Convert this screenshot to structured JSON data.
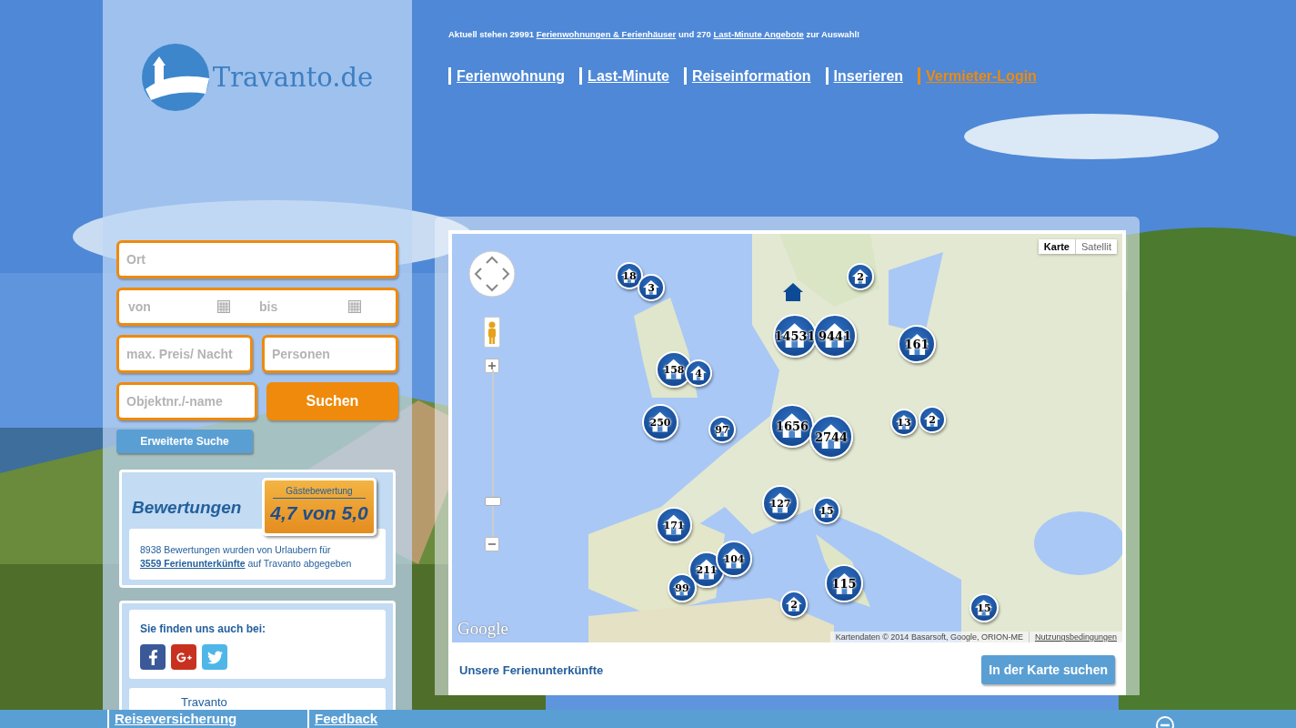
{
  "logo": {
    "text": "Travanto.de"
  },
  "notice": [
    {
      "text": "Aktuell stehen 29991 ",
      "link": false
    },
    {
      "text": "Ferienwohnungen & Ferienhäuser",
      "link": true
    },
    {
      "text": " und 270 ",
      "link": false
    },
    {
      "text": "Last-Minute Angebote",
      "link": true
    },
    {
      "text": " zur Auswahl!",
      "link": false
    }
  ],
  "nav": [
    {
      "label": "Ferienwohnung",
      "accent": false
    },
    {
      "label": "Last-Minute",
      "accent": false
    },
    {
      "label": "Reiseinformation",
      "accent": false
    },
    {
      "label": "Inserieren",
      "accent": false
    },
    {
      "label": "Vermieter-Login",
      "accent": true
    }
  ],
  "search": {
    "place": {
      "placeholder": "Ort"
    },
    "from": {
      "placeholder": "von"
    },
    "to": {
      "placeholder": "bis"
    },
    "price": {
      "placeholder": "max. Preis/ Nacht"
    },
    "persons": {
      "placeholder": "Personen"
    },
    "object": {
      "placeholder": "Objektnr./-name"
    },
    "submit": "Suchen",
    "advanced": "Erweiterte Suche"
  },
  "reviews": {
    "title": "Bewertungen",
    "badge_label": "Gästebewertung",
    "badge_score": "4,7 von 5,0",
    "text": [
      {
        "text": "8938 Bewertungen wurden von Urlaubern für ",
        "link": false
      },
      {
        "text": "3559 Ferienunterkünfte",
        "link": true
      },
      {
        "text": " auf Travanto abgegeben",
        "link": false
      }
    ]
  },
  "social": {
    "title": "Sie finden uns auch bei:",
    "networks": [
      {
        "kind": "facebook"
      },
      {
        "kind": "googleplus"
      },
      {
        "kind": "twitter"
      }
    ]
  },
  "more_box": {
    "title": "Travanto"
  },
  "map": {
    "types": [
      {
        "label": "Karte",
        "selected": true
      },
      {
        "label": "Satellit",
        "selected": false
      }
    ],
    "zoom": {
      "level": 0.21
    },
    "markers": [
      {
        "count": "18"
      },
      {
        "count": "3"
      },
      {
        "count": "2"
      },
      {
        "count": "14531"
      },
      {
        "count": "9441"
      },
      {
        "count": "161"
      },
      {
        "count": "158"
      },
      {
        "count": "4"
      },
      {
        "count": "250"
      },
      {
        "count": "97"
      },
      {
        "count": "1656"
      },
      {
        "count": "2744"
      },
      {
        "count": "13"
      },
      {
        "count": "2"
      },
      {
        "count": "127"
      },
      {
        "count": "15"
      },
      {
        "count": "171"
      },
      {
        "count": "104"
      },
      {
        "count": "211"
      },
      {
        "count": "99"
      },
      {
        "count": "2"
      },
      {
        "count": "115"
      },
      {
        "count": "15"
      }
    ],
    "logo": "Google",
    "attribution": "Kartendaten © 2014 Basarsoft, Google, ORION-ME",
    "terms": "Nutzungsbedingungen"
  },
  "map_footer": {
    "title": "Unsere Ferienunterkünfte",
    "button": "In der Karte suchen"
  },
  "footer": {
    "links": [
      "Reiseversicherung",
      "Feedback"
    ]
  }
}
